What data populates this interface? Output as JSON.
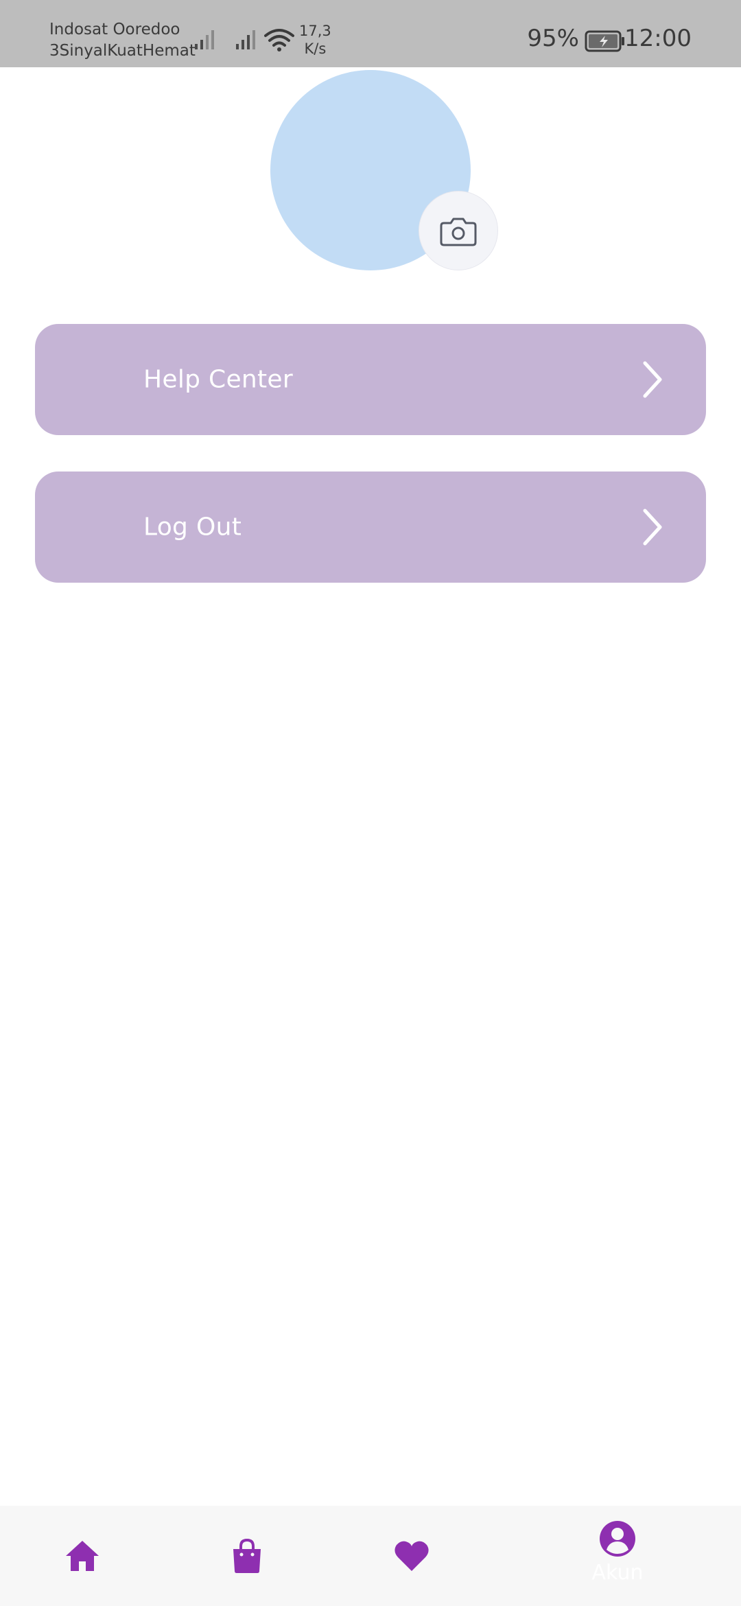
{
  "status_bar": {
    "carrier_line1": "Indosat Ooredoo",
    "carrier_line2": "3SinyalKuatHemat",
    "speed_value": "17,3",
    "speed_unit": "K/s",
    "battery_percent": "95%",
    "time": "12:00"
  },
  "menu": {
    "help_center_label": "Help Center",
    "log_out_label": "Log Out"
  },
  "bottom_nav": {
    "account_label": "Akun"
  },
  "colors": {
    "accent": "#8e2fb0",
    "menu_background": "#c5b4d5",
    "avatar_placeholder": "#c2dcf5",
    "status_bar": "#bdbdbd"
  },
  "icons": {
    "camera": "camera-icon",
    "chevron": "chevron-right-icon",
    "home": "home-icon",
    "shop": "shopping-bag-icon",
    "favorites": "heart-icon",
    "account": "user-circle-icon"
  }
}
